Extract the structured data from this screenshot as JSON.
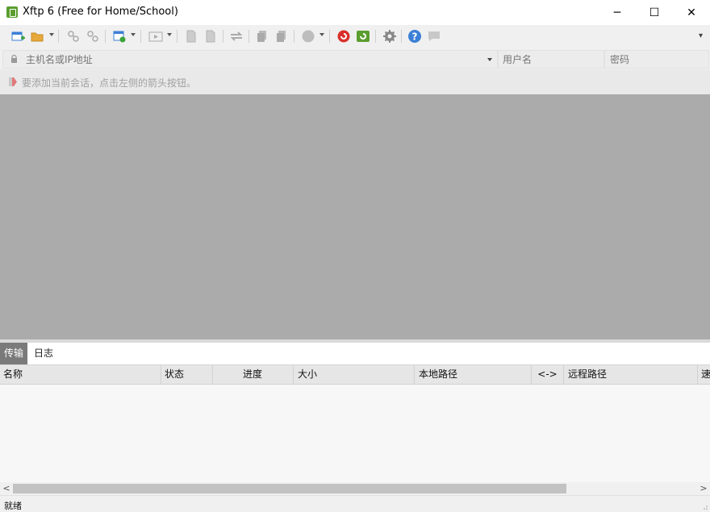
{
  "window": {
    "title": "Xftp 6 (Free for Home/School)",
    "controls": {
      "minimize": "─",
      "maximize": "☐",
      "close": "✕"
    }
  },
  "toolbar": {
    "icons": [
      "new-session-icon",
      "open-folder-icon",
      "connect-icon",
      "disconnect-icon",
      "session-properties-icon",
      "play-icon",
      "new-file-icon",
      "copy-file-icon",
      "transfer-icon",
      "page-icon",
      "page-copy-icon",
      "status-circle-icon",
      "xshell-icon",
      "xftp-icon",
      "settings-gear-icon",
      "help-icon",
      "chat-icon"
    ],
    "overflow": "▾"
  },
  "address_bar": {
    "host_placeholder": "主机名或IP地址",
    "username_placeholder": "用户名",
    "password_placeholder": "密码"
  },
  "hint": {
    "text": "要添加当前会话，点击左侧的箭头按钮。"
  },
  "bottom_panel": {
    "tabs": [
      {
        "label": "传输",
        "active": true
      },
      {
        "label": "日志",
        "active": false
      }
    ],
    "columns": [
      "名称",
      "状态",
      "进度",
      "大小",
      "本地路径",
      "<->",
      "远程路径",
      "速"
    ]
  },
  "scrollbar": {
    "left_arrow": "<",
    "right_arrow": ">"
  },
  "status": {
    "text": "就绪"
  },
  "colors": {
    "workspace": "#ababab",
    "active_tab": "#7a7a7a",
    "xftp_green": "#5a9e2f",
    "xshell_red": "#d9302a",
    "help_blue": "#3b7fd6"
  }
}
